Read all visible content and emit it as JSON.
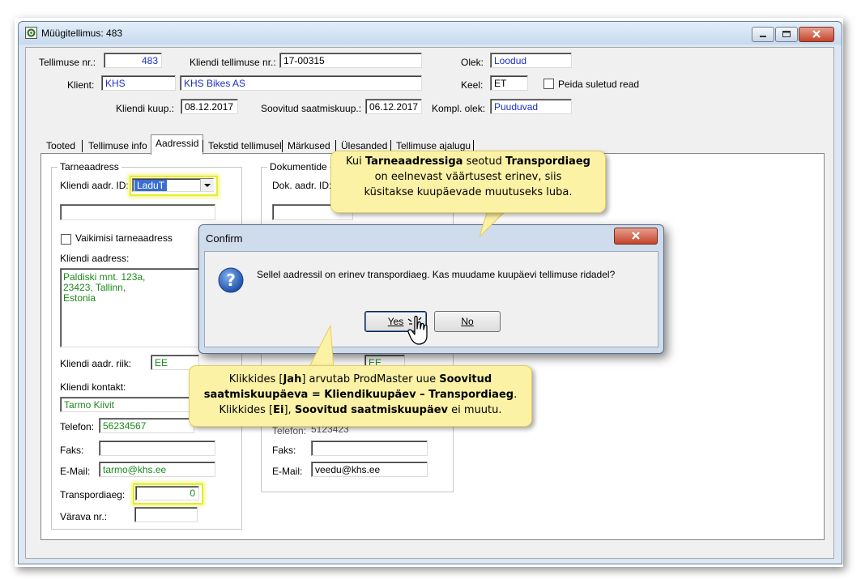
{
  "window": {
    "title": "Müügitellimus: 483"
  },
  "header": {
    "order_no_label": "Tellimuse nr.:",
    "order_no": "483",
    "client_order_no_label": "Kliendi tellimuse nr.:",
    "client_order_no": "17-00315",
    "state_label": "Olek:",
    "state": "Loodud",
    "client_label": "Klient:",
    "client_code": "KHS",
    "client_name": "KHS Bikes AS",
    "language_label": "Keel:",
    "language": "ET",
    "hide_closed_label": "Peida suletud read",
    "client_date_label": "Kliendi kuup.:",
    "client_date": "08.12.2017",
    "desired_date_label": "Soovitud saatmiskuup.:",
    "desired_date": "06.12.2017",
    "compl_state_label": "Kompl. olek:",
    "compl_state": "Puuduvad"
  },
  "tabs": [
    "Tooted",
    "Tellimuse info",
    "Aadressid",
    "Tekstid tellimusel",
    "Märkused",
    "Ülesanded",
    "Tellimuse ajalugu"
  ],
  "delivery": {
    "group_title": "Tarneaadress",
    "addr_id_label": "Kliendi aadr. ID:",
    "addr_id": "LaduT",
    "default_label": "Vaikimisi tarneaadress",
    "address_label": "Kliendi aadress:",
    "address_line1": "Paldiski mnt. 123a,",
    "address_line2": "23423, Tallinn,",
    "address_line3": "Estonia",
    "country_label": "Kliendi aadr. riik:",
    "country": "EE",
    "contact_label": "Kliendi kontakt:",
    "contact": "Tarmo Kiivit",
    "phone_label": "Telefon:",
    "phone": "56234567",
    "fax_label": "Faks:",
    "email_label": "E-Mail:",
    "email": "tarmo@khs.ee",
    "transport_label": "Transpordiaeg:",
    "transport": "0",
    "gate_label": "Värava nr.:"
  },
  "documents": {
    "group_title": "Dokumentide",
    "addr_id_label": "Dok. aadr. ID:",
    "country": "EE",
    "phone_label": "Telefon:",
    "phone": "5123423",
    "fax_label": "Faks:",
    "email_label": "E-Mail:",
    "email": "veedu@khs.ee"
  },
  "dialog": {
    "title": "Confirm",
    "message": "Sellel aadressil on erinev transpordiaeg. Kas muudame kuupäevi tellimuse ridadel?",
    "yes_label": "Yes",
    "no_label": "No"
  },
  "callout_top": {
    "t1": "Kui ",
    "b1": "Tarneaadressiga",
    "t2": " seotud ",
    "b2": "Transpordiaeg",
    "line2": "on eelnevast väärtusest erinev, siis",
    "line3": "küsitakse kuupäevade muutuseks luba."
  },
  "callout_bottom": {
    "t1": "Klikkides [",
    "b1": "Jah",
    "t2": "] arvutab ProdMaster uue ",
    "b2": "Soovitud",
    "b3": "saatmiskuupäeva = Kliendikuupäev – Transpordiaeg",
    "t3": ".",
    "t4": "Klikkides [",
    "b4": "Ei",
    "t5": "],  ",
    "b5": "Soovitud saatmiskuupäev",
    "t6": " ei muutu."
  },
  "colors": {
    "field_blue_text": "#1c2fc9",
    "field_green_text": "#1b8a1b",
    "callout_bg": "#fcf2a6",
    "highlight": "#e6ee25"
  }
}
